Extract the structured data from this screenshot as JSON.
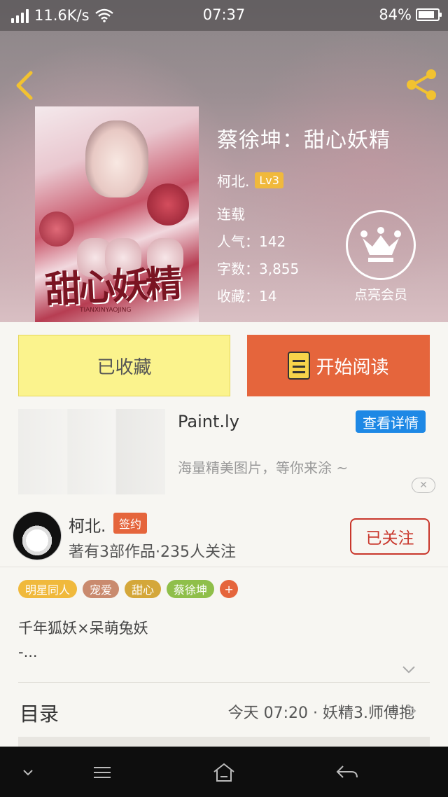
{
  "status_bar": {
    "network_speed": "11.6K/s",
    "time": "07:37",
    "battery": "84%",
    "battery_level": 0.84
  },
  "book": {
    "title": "蔡徐坤：甜心妖精",
    "author": "柯北.",
    "author_level": "Lv3",
    "status": "连载",
    "popularity": "人气：142",
    "word_count": "字数：3,855",
    "favorites": "收藏：14",
    "cover_title": "甜心妖精",
    "cover_subtitle": "TIANXINYAOJING"
  },
  "vip": {
    "label": "点亮会员"
  },
  "actions": {
    "favorited_label": "已收藏",
    "read_label": "开始阅读"
  },
  "ad": {
    "title": "Paint.ly",
    "detail_label": "查看详情",
    "description": "海量精美图片，等你来涂 ~",
    "close_label": "✕"
  },
  "author_card": {
    "name": "柯北.",
    "badge": "签约",
    "meta": "著有3部作品·235人关注",
    "follow_label": "已关注"
  },
  "tags": [
    {
      "label": "明星同人",
      "color": "#f0b93c"
    },
    {
      "label": "宠爱",
      "color": "#c98a6e"
    },
    {
      "label": "甜心",
      "color": "#d4a73a"
    },
    {
      "label": "蔡徐坤",
      "color": "#8fbf4a"
    }
  ],
  "tag_more": "+",
  "description": {
    "line1": "千年狐妖×呆萌兔妖",
    "line2": "-..."
  },
  "toc": {
    "label": "目录",
    "latest": "今天 07:20 · 妖精3.师傅抱"
  },
  "colors": {
    "accent_orange": "#e5653c",
    "favorite_yellow": "#fbf38d",
    "link_blue": "#1e88e5",
    "follow_red": "#c9372c"
  }
}
